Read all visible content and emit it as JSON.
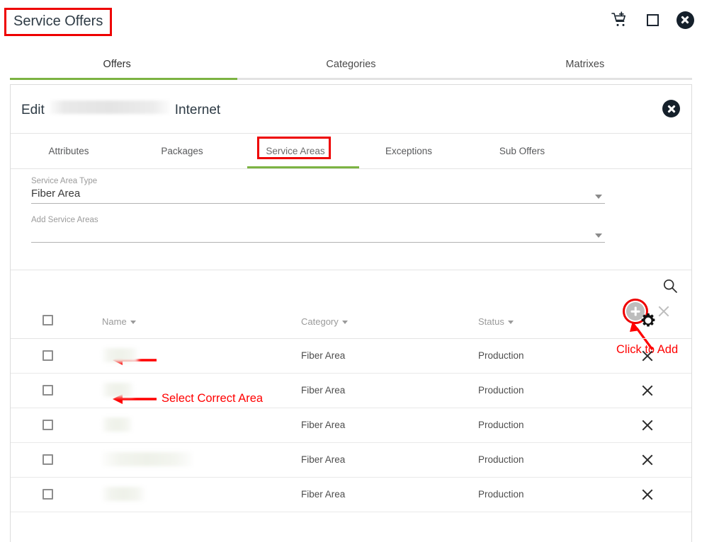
{
  "app": {
    "page_title": "Service Offers"
  },
  "topbar": {
    "icons": [
      {
        "name": "add-to-cart-icon",
        "label": "cart-plus"
      },
      {
        "name": "maximize-icon",
        "label": "square"
      },
      {
        "name": "close-window-icon",
        "label": "circle-x"
      }
    ]
  },
  "main_tabs": [
    {
      "label": "Offers",
      "active": true
    },
    {
      "label": "Categories",
      "active": false
    },
    {
      "label": "Matrixes",
      "active": false
    }
  ],
  "panel": {
    "title_prefix": "Edit",
    "title_redacted": "",
    "title_suffix": "Internet",
    "close_label": "Close"
  },
  "sub_tabs": [
    {
      "label": "Attributes",
      "active": false
    },
    {
      "label": "Packages",
      "active": false
    },
    {
      "label": "Service Areas",
      "active": true
    },
    {
      "label": "Exceptions",
      "active": false
    },
    {
      "label": "Sub Offers",
      "active": false
    }
  ],
  "form": {
    "service_area_type": {
      "label": "Service Area Type",
      "value": "Fiber Area"
    },
    "add_service_areas": {
      "label": "Add Service Areas",
      "value": "",
      "placeholder": ""
    },
    "add_button_label": "+",
    "cancel_button_label": "×"
  },
  "annotations": [
    {
      "text": "Select Correct Area",
      "color": "#ff0000"
    },
    {
      "text": "Click to Add",
      "color": "#ff0000"
    }
  ],
  "table": {
    "search_label": "Search",
    "settings_label": "Column settings",
    "columns": [
      {
        "key": "check",
        "label": ""
      },
      {
        "key": "name",
        "label": "Name",
        "sortable": true
      },
      {
        "key": "category",
        "label": "Category",
        "sortable": true
      },
      {
        "key": "status",
        "label": "Status",
        "sortable": true
      },
      {
        "key": "actions",
        "label": ""
      }
    ],
    "rows": [
      {
        "name": "",
        "name_width": 51,
        "category": "Fiber Area",
        "status": "Production"
      },
      {
        "name": "",
        "name_width": 45,
        "category": "Fiber Area",
        "status": "Production"
      },
      {
        "name": "",
        "name_width": 43,
        "category": "Fiber Area",
        "status": "Production"
      },
      {
        "name": "",
        "name_width": 128,
        "category": "Fiber Area",
        "status": "Production"
      },
      {
        "name": "",
        "name_width": 61,
        "category": "Fiber Area",
        "status": "Production"
      }
    ]
  },
  "colors": {
    "accent_green": "#7cb342",
    "annotation_red": "#ff0000",
    "text_dark": "#2e3b45",
    "text_muted": "#9a9a9a",
    "border": "#e4e4e4"
  }
}
